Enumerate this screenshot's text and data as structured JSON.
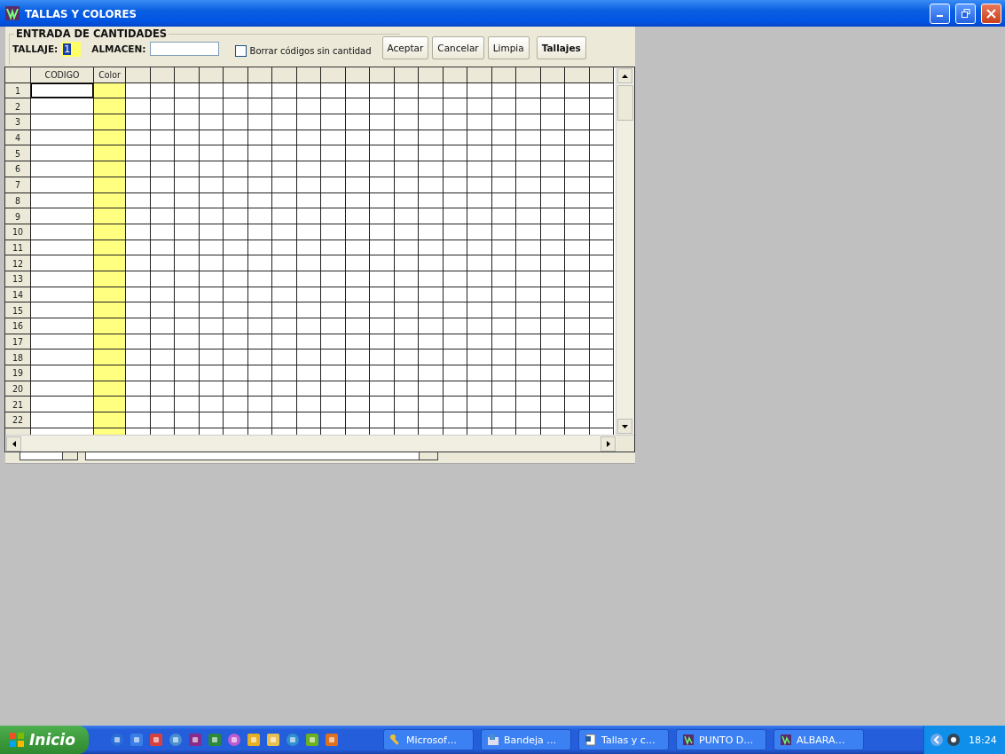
{
  "window": {
    "title": "TALLAS Y COLORES"
  },
  "entry": {
    "group_label": "ENTRADA DE CANTIDADES",
    "tallaje_label": "TALLAJE:",
    "tallaje_value": "1",
    "almacen_label": "ALMACEN:",
    "checkbox": {
      "label": "Borrar códigos sin cantidad",
      "checked": false
    },
    "buttons": [
      {
        "label": "Aceptar",
        "bold": false
      },
      {
        "label": "Cancelar",
        "bold": false
      },
      {
        "label": "Limpia",
        "bold": false
      },
      {
        "label": "Tallajes",
        "bold": true
      }
    ]
  },
  "grid": {
    "columns": [
      "CODIGO",
      "Color"
    ],
    "rows": [
      {
        "number": "1",
        "selected": true
      },
      {
        "number": "2",
        "selected": false
      },
      {
        "number": "3",
        "selected": false
      },
      {
        "number": "4",
        "selected": false
      },
      {
        "number": "5",
        "selected": false
      },
      {
        "number": "6",
        "selected": false
      },
      {
        "number": "7",
        "selected": false
      },
      {
        "number": "8",
        "selected": false
      },
      {
        "number": "9",
        "selected": false
      },
      {
        "number": "10",
        "selected": false
      },
      {
        "number": "11",
        "selected": false
      },
      {
        "number": "12",
        "selected": false
      },
      {
        "number": "13",
        "selected": false
      },
      {
        "number": "14",
        "selected": false
      },
      {
        "number": "15",
        "selected": false
      },
      {
        "number": "16",
        "selected": false
      },
      {
        "number": "17",
        "selected": false
      },
      {
        "number": "18",
        "selected": false
      },
      {
        "number": "19",
        "selected": false
      },
      {
        "number": "20",
        "selected": false
      },
      {
        "number": "21",
        "selected": false
      },
      {
        "number": "22",
        "selected": false
      }
    ]
  },
  "taskbar": {
    "start": "Inicio",
    "tasks": [
      {
        "label": "Microsof…",
        "kind": "key"
      },
      {
        "label": "Bandeja …",
        "kind": "mail"
      },
      {
        "label": "Tallas y c…",
        "kind": "doc"
      },
      {
        "label": "PUNTO D…",
        "kind": "app"
      },
      {
        "label": "ALBARA…",
        "kind": "app"
      }
    ],
    "clock": "18:24"
  }
}
